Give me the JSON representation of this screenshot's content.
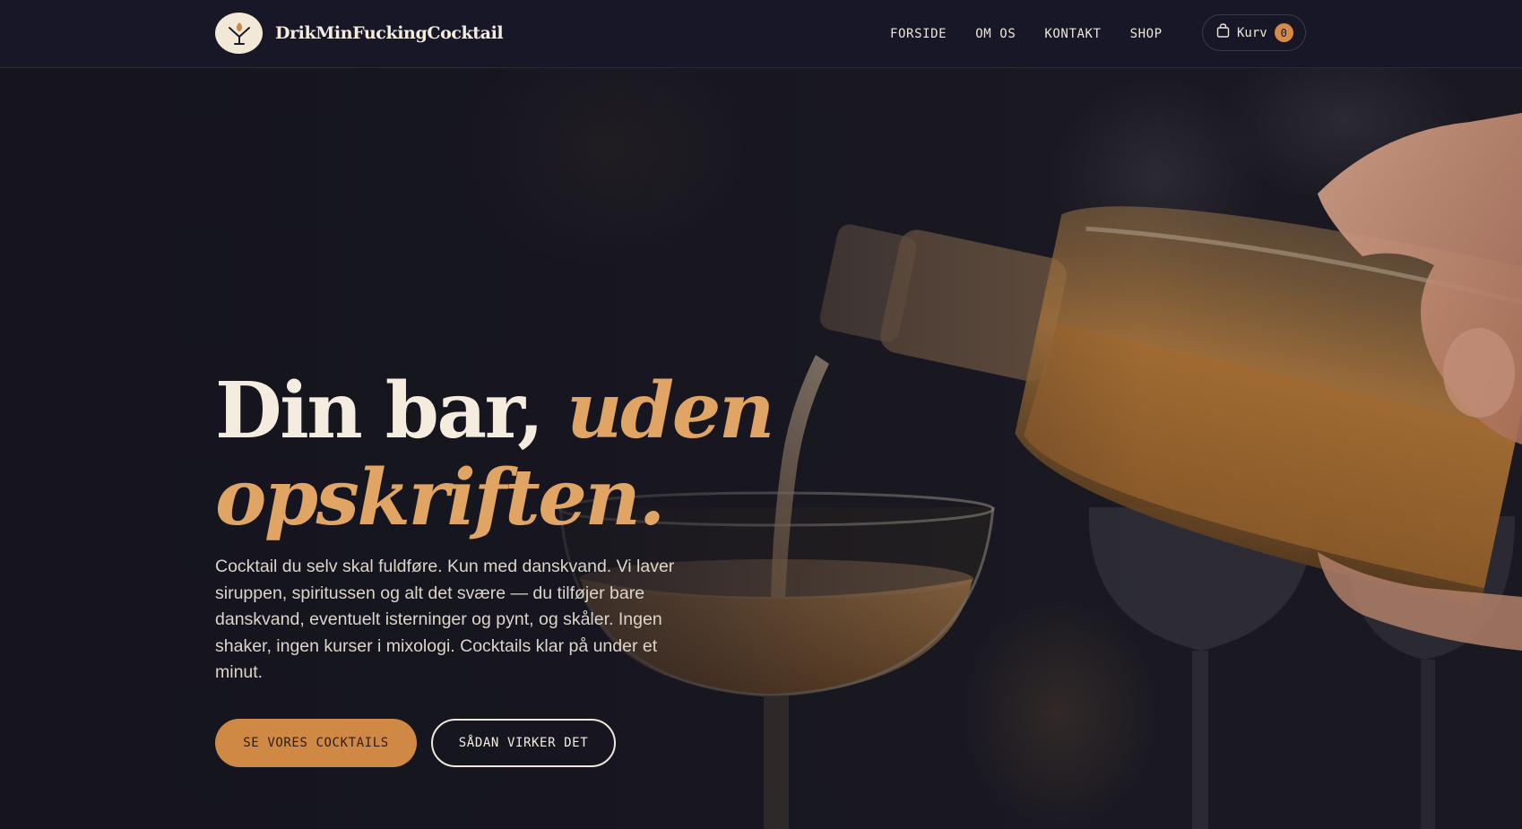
{
  "brand": {
    "name": "DrikMinFuckingCocktail",
    "logo_icon": "cocktail-glass-icon"
  },
  "nav": {
    "items": [
      {
        "label": "FORSIDE"
      },
      {
        "label": "OM OS"
      },
      {
        "label": "KONTAKT"
      },
      {
        "label": "SHOP"
      }
    ]
  },
  "cart": {
    "label": "Kurv",
    "count": "0",
    "icon": "shopping-bag-icon"
  },
  "hero": {
    "title_part1": "Din bar,",
    "title_part2": "uden opskriften.",
    "body": "Cocktail du selv skal fuldføre. Kun med danskvand. Vi laver siruppen, spiritussen og alt det svære — du tilføjer bare danskvand, eventuelt isterninger og pynt, og skåler. Ingen shaker, ingen kurser i mixologi. Cocktails klar på under et minut.",
    "cta_primary": "SE VORES COCKTAILS",
    "cta_secondary": "SÅDAN VIRKER DET",
    "image_subject": "hand pouring amber liquor from a bottle into a coupe glass"
  },
  "colors": {
    "background": "#16151f",
    "header": "#181727",
    "accent": "#e0a465",
    "button": "#d08945",
    "text": "#f4ecdf"
  }
}
